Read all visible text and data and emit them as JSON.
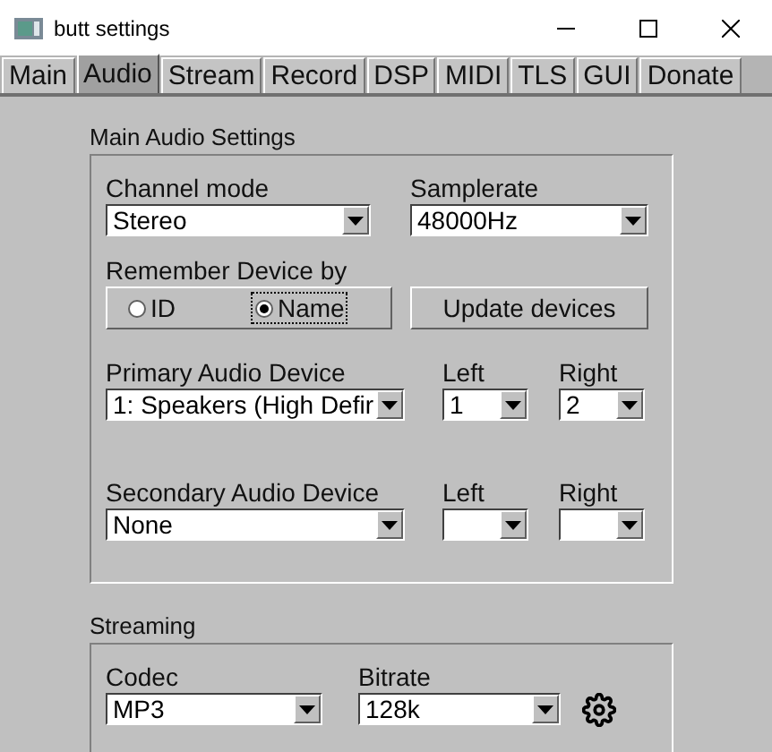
{
  "window": {
    "title": "butt settings"
  },
  "tabs": [
    {
      "label": "Main",
      "selected": false
    },
    {
      "label": "Audio",
      "selected": true
    },
    {
      "label": "Stream",
      "selected": false
    },
    {
      "label": "Record",
      "selected": false
    },
    {
      "label": "DSP",
      "selected": false
    },
    {
      "label": "MIDI",
      "selected": false
    },
    {
      "label": "TLS",
      "selected": false
    },
    {
      "label": "GUI",
      "selected": false
    },
    {
      "label": "Donate",
      "selected": false
    }
  ],
  "main_audio": {
    "title": "Main Audio Settings",
    "channel_mode": {
      "label": "Channel mode",
      "value": "Stereo"
    },
    "samplerate": {
      "label": "Samplerate",
      "value": "48000Hz"
    },
    "remember": {
      "label": "Remember Device by",
      "options": [
        {
          "label": "ID",
          "selected": false
        },
        {
          "label": "Name",
          "selected": true
        }
      ]
    },
    "update_button": "Update devices",
    "devices": [
      {
        "label": "Primary Audio Device",
        "value": "1: Speakers (High Defir",
        "left": {
          "label": "Left",
          "value": "1"
        },
        "right": {
          "label": "Right",
          "value": "2"
        }
      },
      {
        "label": "Secondary Audio Device",
        "value": "None",
        "left": {
          "label": "Left"
        },
        "right": {
          "label": "Right"
        }
      }
    ]
  },
  "streaming": {
    "title": "Streaming",
    "codec": {
      "label": "Codec",
      "value": "MP3"
    },
    "bitrate": {
      "label": "Bitrate",
      "value": "128k"
    }
  }
}
